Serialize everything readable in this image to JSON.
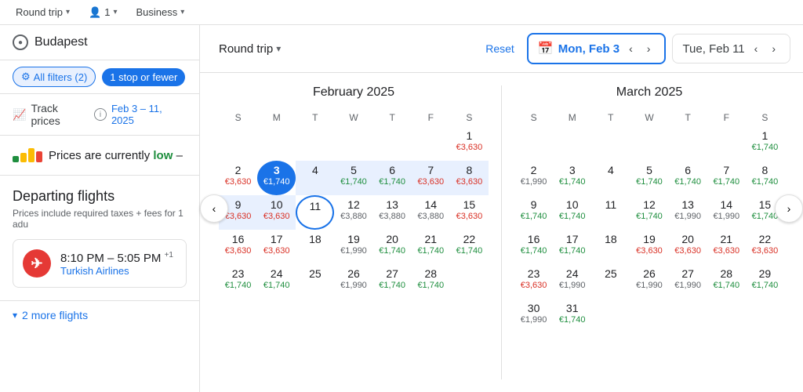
{
  "topbar": {
    "trip_type": "Round trip",
    "passengers": "1",
    "cabin": "Business",
    "chevron": "▾"
  },
  "left": {
    "search": {
      "city": "Budapest"
    },
    "filters": {
      "all_filters": "All filters (2)",
      "stop": "1 stop or fewer"
    },
    "track": {
      "label": "Track prices",
      "dates": "Feb 3 – 11, 2025"
    },
    "price_level": {
      "text_before": "Prices are currently",
      "level": "low",
      "text_after": "–"
    },
    "departing": {
      "title": "Departing flights",
      "subtitle": "Prices include required taxes + fees for 1 adu",
      "flight": {
        "time": "8:10 PM – 5:05 PM",
        "superscript": "+1",
        "airline": "Turkish Airlines"
      },
      "more": "2 more flights"
    }
  },
  "calendar": {
    "trip_type": "Round trip",
    "reset": "Reset",
    "date_from": "Mon, Feb 3",
    "date_to": "Tue, Feb 11",
    "months": [
      {
        "title": "February 2025",
        "dow": [
          "S",
          "M",
          "T",
          "W",
          "T",
          "F",
          "S"
        ],
        "weeks": [
          [
            {
              "day": "",
              "price": ""
            },
            {
              "day": "",
              "price": ""
            },
            {
              "day": "",
              "price": ""
            },
            {
              "day": "",
              "price": ""
            },
            {
              "day": "",
              "price": ""
            },
            {
              "day": "",
              "price": ""
            },
            {
              "day": "1",
              "price": "€3,630",
              "price_type": "red"
            }
          ],
          [
            {
              "day": "2",
              "price": "€3,630",
              "price_type": "red"
            },
            {
              "day": "3",
              "price": "€1,740",
              "price_type": "green",
              "selected": "start"
            },
            {
              "day": "4",
              "price": "",
              "price_type": ""
            },
            {
              "day": "5",
              "price": "€1,740",
              "price_type": "green"
            },
            {
              "day": "6",
              "price": "€1,740",
              "price_type": "green"
            },
            {
              "day": "7",
              "price": "€3,630",
              "price_type": "red"
            },
            {
              "day": "8",
              "price": "€3,630",
              "price_type": "red"
            }
          ],
          [
            {
              "day": "9",
              "price": "€3,630",
              "price_type": "red"
            },
            {
              "day": "10",
              "price": "€3,630",
              "price_type": "red"
            },
            {
              "day": "11",
              "price": "",
              "price_type": "",
              "selected": "end"
            },
            {
              "day": "12",
              "price": "€3,880",
              "price_type": "gray"
            },
            {
              "day": "13",
              "price": "€3,880",
              "price_type": "gray"
            },
            {
              "day": "14",
              "price": "€3,880",
              "price_type": "gray"
            },
            {
              "day": "15",
              "price": "€3,630",
              "price_type": "red"
            }
          ],
          [
            {
              "day": "16",
              "price": "€3,630",
              "price_type": "red"
            },
            {
              "day": "17",
              "price": "€3,630",
              "price_type": "red"
            },
            {
              "day": "18",
              "price": "",
              "price_type": ""
            },
            {
              "day": "19",
              "price": "€1,990",
              "price_type": "gray"
            },
            {
              "day": "20",
              "price": "€1,740",
              "price_type": "green"
            },
            {
              "day": "21",
              "price": "€1,740",
              "price_type": "green"
            },
            {
              "day": "22",
              "price": "€1,740",
              "price_type": "green"
            }
          ],
          [
            {
              "day": "23",
              "price": "€1,740",
              "price_type": "green"
            },
            {
              "day": "24",
              "price": "€1,740",
              "price_type": "green"
            },
            {
              "day": "25",
              "price": "",
              "price_type": ""
            },
            {
              "day": "26",
              "price": "€1,990",
              "price_type": "gray"
            },
            {
              "day": "27",
              "price": "€1,740",
              "price_type": "green"
            },
            {
              "day": "28",
              "price": "€1,740",
              "price_type": "green"
            },
            {
              "day": "",
              "price": ""
            }
          ]
        ]
      },
      {
        "title": "March 2025",
        "dow": [
          "S",
          "M",
          "T",
          "W",
          "T",
          "F",
          "S"
        ],
        "weeks": [
          [
            {
              "day": "",
              "price": ""
            },
            {
              "day": "",
              "price": ""
            },
            {
              "day": "",
              "price": ""
            },
            {
              "day": "",
              "price": ""
            },
            {
              "day": "",
              "price": ""
            },
            {
              "day": "",
              "price": ""
            },
            {
              "day": "1",
              "price": "€1,740",
              "price_type": "green"
            }
          ],
          [
            {
              "day": "2",
              "price": "€1,990",
              "price_type": "gray"
            },
            {
              "day": "3",
              "price": "€1,740",
              "price_type": "green"
            },
            {
              "day": "4",
              "price": "",
              "price_type": ""
            },
            {
              "day": "5",
              "price": "€1,740",
              "price_type": "green"
            },
            {
              "day": "6",
              "price": "€1,740",
              "price_type": "green"
            },
            {
              "day": "7",
              "price": "€1,740",
              "price_type": "green"
            },
            {
              "day": "8",
              "price": "€1,740",
              "price_type": "green"
            }
          ],
          [
            {
              "day": "9",
              "price": "€1,740",
              "price_type": "green"
            },
            {
              "day": "10",
              "price": "€1,740",
              "price_type": "green"
            },
            {
              "day": "11",
              "price": "",
              "price_type": ""
            },
            {
              "day": "12",
              "price": "€1,740",
              "price_type": "green"
            },
            {
              "day": "13",
              "price": "€1,990",
              "price_type": "gray"
            },
            {
              "day": "14",
              "price": "€1,990",
              "price_type": "gray"
            },
            {
              "day": "15",
              "price": "€1,740",
              "price_type": "green"
            }
          ],
          [
            {
              "day": "16",
              "price": "€1,740",
              "price_type": "green"
            },
            {
              "day": "17",
              "price": "€1,740",
              "price_type": "green"
            },
            {
              "day": "18",
              "price": "",
              "price_type": ""
            },
            {
              "day": "19",
              "price": "€3,630",
              "price_type": "red"
            },
            {
              "day": "20",
              "price": "€3,630",
              "price_type": "red"
            },
            {
              "day": "21",
              "price": "€3,630",
              "price_type": "red"
            },
            {
              "day": "22",
              "price": "€3,630",
              "price_type": "red"
            }
          ],
          [
            {
              "day": "23",
              "price": "€3,630",
              "price_type": "red"
            },
            {
              "day": "24",
              "price": "€1,990",
              "price_type": "gray"
            },
            {
              "day": "25",
              "price": "",
              "price_type": ""
            },
            {
              "day": "26",
              "price": "€1,990",
              "price_type": "gray"
            },
            {
              "day": "27",
              "price": "€1,990",
              "price_type": "gray"
            },
            {
              "day": "28",
              "price": "€1,740",
              "price_type": "green"
            },
            {
              "day": "29",
              "price": "€1,740",
              "price_type": "green"
            }
          ],
          [
            {
              "day": "30",
              "price": "€1,990",
              "price_type": "gray"
            },
            {
              "day": "31",
              "price": "€1,740",
              "price_type": "green"
            },
            {
              "day": "",
              "price": ""
            },
            {
              "day": "",
              "price": ""
            },
            {
              "day": "",
              "price": ""
            },
            {
              "day": "",
              "price": ""
            },
            {
              "day": "",
              "price": ""
            }
          ]
        ]
      }
    ]
  }
}
